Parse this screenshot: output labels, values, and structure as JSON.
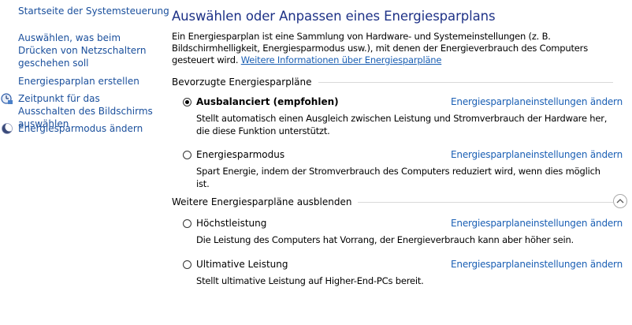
{
  "sidebar": {
    "items": [
      {
        "label": "Startseite der Systemsteuerung"
      },
      {
        "label": "Auswählen, was beim Drücken von Netzschaltern geschehen soll"
      },
      {
        "label": "Energiesparplan erstellen"
      },
      {
        "label": "Zeitpunkt für das Ausschalten des Bildschirms auswählen",
        "icon": "clock-icon"
      },
      {
        "label": "Energiesparmodus ändern",
        "icon": "moon-icon"
      }
    ]
  },
  "main": {
    "title": "Auswählen oder Anpassen eines Energiesparplans",
    "intro_text": "Ein Energiesparplan ist eine Sammlung von Hardware- und Systemeinstellungen (z. B. Bildschirmhelligkeit, Energiesparmodus usw.), mit denen der Energieverbrauch des Computers gesteuert wird.",
    "intro_link": "Weitere Informationen über Energiesparpläne",
    "preferred_heading": "Bevorzugte Energiesparpläne",
    "hidden_heading": "Weitere Energiesparpläne ausblenden",
    "change_link": "Energiesparplaneinstellungen ändern",
    "plans": [
      {
        "name": "Ausbalanciert (empfohlen)",
        "selected": true,
        "desc": "Stellt automatisch einen Ausgleich zwischen Leistung und Stromverbrauch der Hardware her, die diese Funktion unterstützt."
      },
      {
        "name": "Energiesparmodus",
        "selected": false,
        "desc": "Spart Energie, indem der Stromverbrauch des Computers reduziert wird, wenn dies möglich ist."
      },
      {
        "name": "Höchstleistung",
        "selected": false,
        "desc": "Die Leistung des Computers hat Vorrang, der Energieverbrauch kann aber höher sein."
      },
      {
        "name": "Ultimative Leistung",
        "selected": false,
        "desc": "Stellt ultimative Leistung auf Higher-End-PCs bereit."
      }
    ]
  },
  "colors": {
    "title": "#1e3287",
    "link": "#1a5fb4",
    "sidebar_link": "#1a4f9c"
  }
}
